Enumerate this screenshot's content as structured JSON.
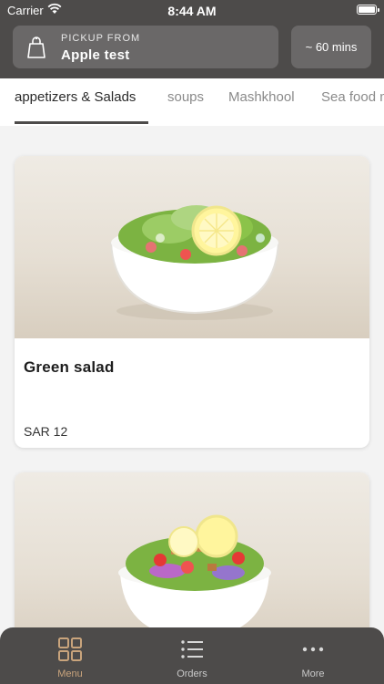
{
  "status_bar": {
    "carrier": "Carrier",
    "time": "8:44 AM"
  },
  "pickup": {
    "label": "PICKUP FROM",
    "store": "Apple test",
    "icon": "shopping-bag-icon"
  },
  "eta": "~ 60 mins",
  "tabs": [
    {
      "label": "appetizers &  Salads",
      "active": true
    },
    {
      "label": "soups",
      "active": false
    },
    {
      "label": "Mashkhool",
      "active": false
    },
    {
      "label": "Sea food m",
      "active": false
    }
  ],
  "menu_items": [
    {
      "name": "Green salad",
      "price": "SAR 12",
      "image": "green-salad-bowl"
    },
    {
      "name": "",
      "price": "",
      "image": "fattoush-salad-bowl"
    }
  ],
  "bottom_nav": [
    {
      "label": "Menu",
      "icon": "grid-icon",
      "active": true
    },
    {
      "label": "Orders",
      "icon": "list-icon",
      "active": false
    },
    {
      "label": "More",
      "icon": "more-dots-icon",
      "active": false
    }
  ],
  "colors": {
    "header_bg": "#4d4b4a",
    "button_bg": "#6a6868",
    "active_nav": "#c9a47c",
    "feed_bg": "#f3f3f3"
  }
}
